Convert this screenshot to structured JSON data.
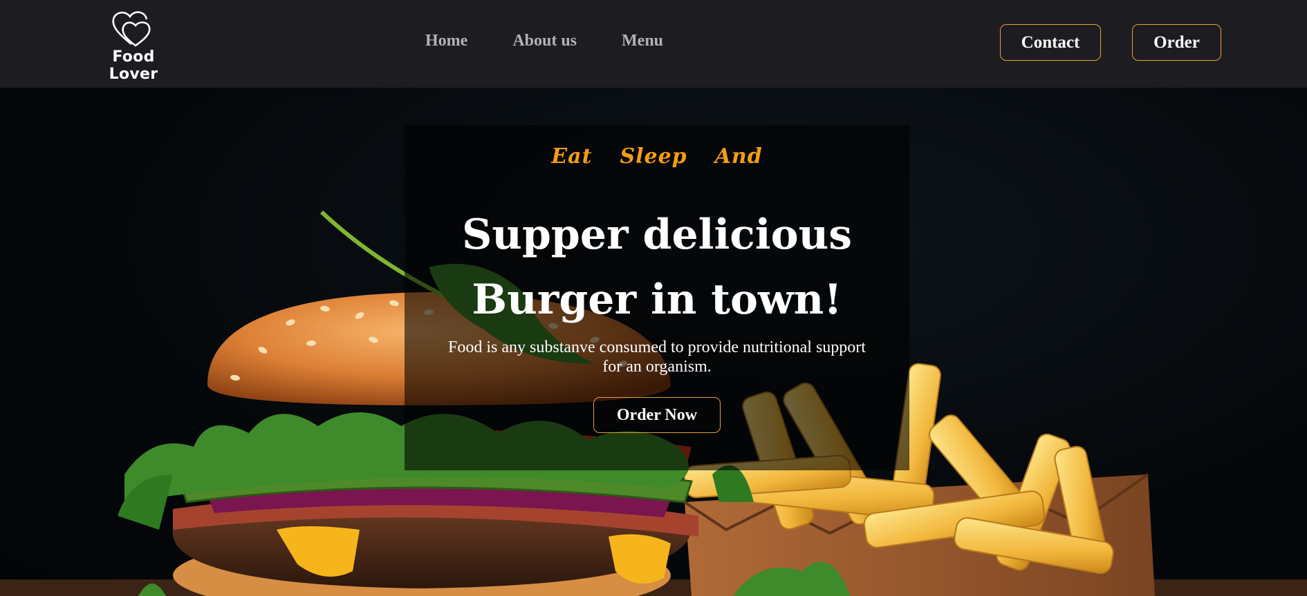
{
  "brand": {
    "name": "Food Lover",
    "logo_icon": "double-heart-icon"
  },
  "nav": {
    "links": [
      {
        "label": "Home"
      },
      {
        "label": "About us"
      },
      {
        "label": "Menu"
      }
    ],
    "contact_label": "Contact",
    "order_label": "Order"
  },
  "hero": {
    "tagline": [
      "Eat",
      "Sleep",
      "And"
    ],
    "headline_line1": "Supper delicious",
    "headline_line2": "Burger in town!",
    "subtext": "Food is any substanve consumed to provide nutritional support for an organism.",
    "cta_label": "Order Now",
    "image_subject": "burger-and-fries-photo"
  },
  "colors": {
    "navbar_bg": "#1d1c21",
    "accent": "#e7a136",
    "tagline": "#f59d12",
    "nav_link": "#b3b3b3",
    "hero_bg": "#05080b"
  }
}
